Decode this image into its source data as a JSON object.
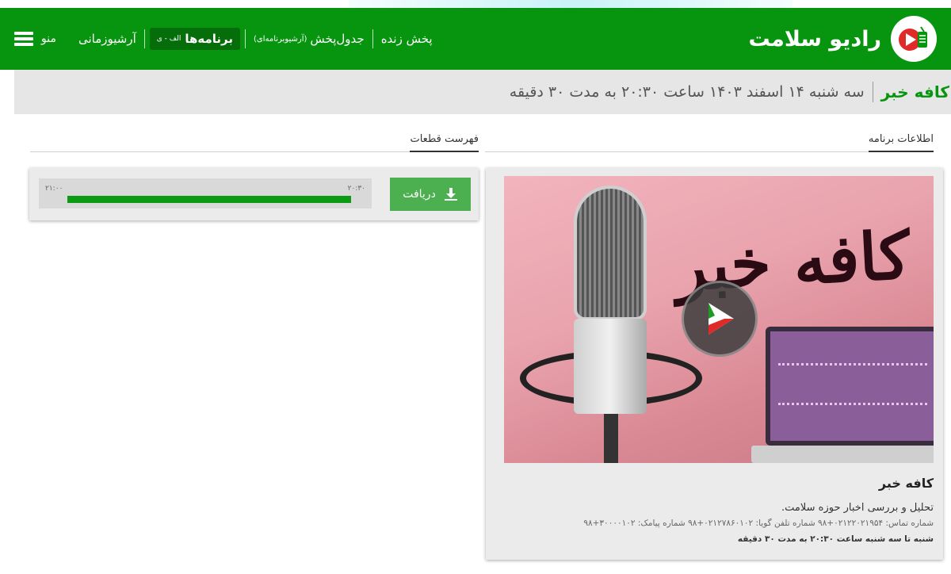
{
  "header": {
    "brand_title": "رادیو سلامت",
    "nav": {
      "live": "پخش زنده",
      "schedule": "جدول‌پخش",
      "schedule_note": "(آرشیو‌برنامه‌ای)",
      "programs": "برنامه‌ها",
      "programs_badge": "الف - ی",
      "time_archive": "آرشیوزمانی",
      "menu": "منو"
    }
  },
  "subheader": {
    "program_title": "کافه خبر",
    "broadcast_info": "سه شنبه ۱۴ اسفند ۱۴۰۳ ساعت ۲۰:۳۰ به مدت ۳۰ دقیقه"
  },
  "program_info": {
    "section_title": "اطلاعات برنامه",
    "cover_title": "کافه خبر",
    "name": "کافه خبر",
    "description": "تحلیل و بررسی اخبار حوزه سلامت.",
    "contact": "شماره تماس: ۰۲۱۲۲۰۲۱۹۵۴+۹۸ شماره تلفن گویا: ۰۲۱۲۷۸۶۰۱۰۲+۹۸ شماره پیامک: ۳۰۰۰۰۱۰۲+۹۸",
    "schedule": "شنبه تا سه شنبه ساعت ۲۰:۳۰ به مدت ۳۰ دقیقه"
  },
  "segments": {
    "section_title": "فهرست قطعات",
    "items": [
      {
        "download_label": "دریافت",
        "start_time": "۲۰:۳۰",
        "end_time": "۲۱:۰۰",
        "progress": 1.0
      }
    ]
  },
  "colors": {
    "brand_green": "#07950f",
    "download_green": "#4caf50",
    "timeline_fill": "#0a9b12"
  }
}
